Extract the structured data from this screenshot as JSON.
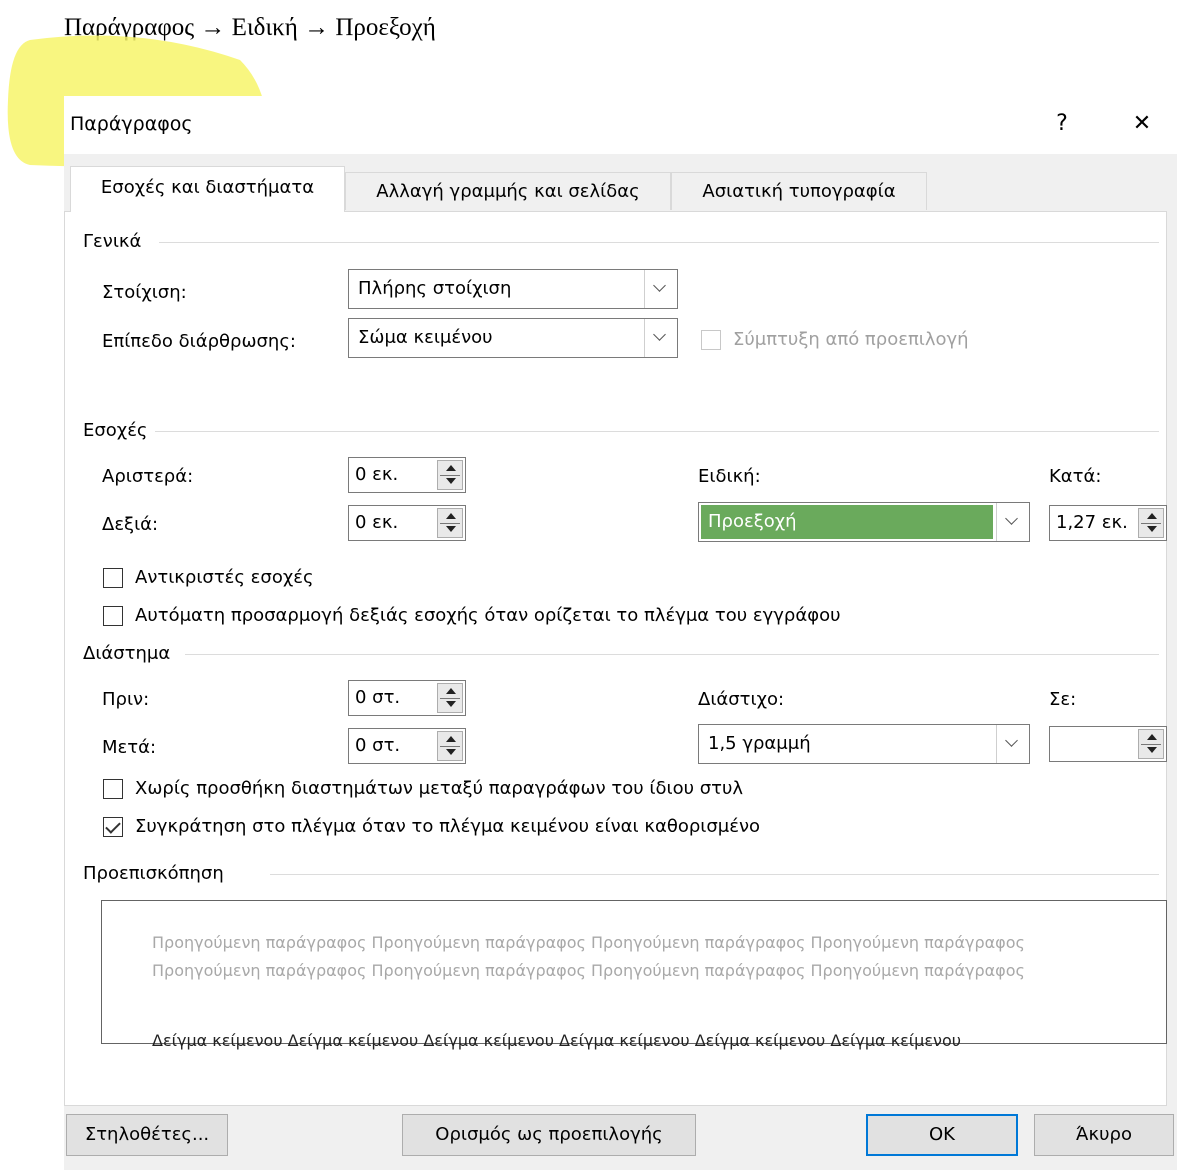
{
  "caption": "Παράγραφος → Ειδική → Προεξοχή",
  "dialog": {
    "title": "Παράγραφος",
    "help_label": "?",
    "close_label": "✕"
  },
  "tabs": [
    {
      "label": "Εσοχές και διαστήματα",
      "active": true
    },
    {
      "label": "Αλλαγή γραμμής και σελίδας",
      "active": false
    },
    {
      "label": "Ασιατική τυπογραφία",
      "active": false
    }
  ],
  "general": {
    "header": "Γενικά",
    "alignment_label": "Στοίχιση:",
    "alignment_value": "Πλήρης στοίχιση",
    "outline_label": "Επίπεδο διάρθρωσης:",
    "outline_value": "Σώμα κειμένου",
    "collapse_label": "Σύμπτυξη από προεπιλογή"
  },
  "indentation": {
    "header": "Εσοχές",
    "left_label": "Αριστερά:",
    "left_value": "0 εκ.",
    "right_label": "Δεξιά:",
    "right_value": "0 εκ.",
    "special_label": "Ειδική:",
    "special_value": "Προεξοχή",
    "by_label": "Κατά:",
    "by_value": "1,27 εκ.",
    "mirror_label": "Αντικριστές εσοχές",
    "auto_adjust_label": "Αυτόματη προσαρμογή δεξιάς εσοχής όταν ορίζεται το πλέγμα του εγγράφου"
  },
  "spacing": {
    "header": "Διάστημα",
    "before_label": "Πριν:",
    "before_value": "0 στ.",
    "after_label": "Μετά:",
    "after_value": "0 στ.",
    "line_spacing_label": "Διάστιχο:",
    "line_spacing_value": "1,5 γραμμή",
    "at_label": "Σε:",
    "at_value": "",
    "no_space_label": "Χωρίς προσθήκη διαστημάτων μεταξύ παραγράφων του ίδιου στυλ",
    "snap_grid_label": "Συγκράτηση στο πλέγμα όταν το πλέγμα κειμένου είναι καθορισμένο"
  },
  "preview": {
    "header": "Προεπισκόπηση",
    "previous_text": "Προηγούμενη παράγραφος Προηγούμενη παράγραφος Προηγούμενη παράγραφος Προηγούμενη παράγραφος Προηγούμενη παράγραφος Προηγούμενη παράγραφος Προηγούμενη παράγραφος Προηγούμενη παράγραφος",
    "sample_text": "Δείγμα κείμενου Δείγμα κείμενου Δείγμα κείμενου Δείγμα κείμενου Δείγμα κείμενου Δείγμα κείμενου"
  },
  "buttons": {
    "tabs_label": "Στηλοθέτες...",
    "set_default_label": "Ορισμός ως προεπιλογής",
    "ok_label": "OK",
    "cancel_label": "Άκυρο"
  },
  "colors": {
    "highlight": "#f7f56a",
    "selection": "#6aaa5c",
    "default_button_border": "#0078d7"
  }
}
